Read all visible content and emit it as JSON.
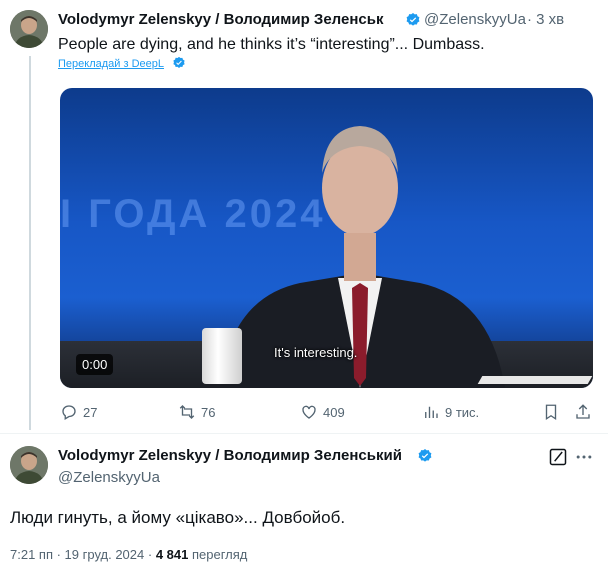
{
  "reply_tweet": {
    "author_name": "Volodymyr Zelenskyy / Володимир Зеленськ",
    "author_handle": "@ZelenskyyUa",
    "time_ago": "· 3 хв",
    "text": "People are dying, and he thinks it’s “interesting”... Dumbass.",
    "translate_label": "Перекладай з DeepL",
    "video": {
      "subtitle": "It's interesting.",
      "timecode": "0:00",
      "background_text": "І ГОДА 2024"
    },
    "actions": {
      "replies": "27",
      "reposts": "76",
      "likes": "409",
      "views": "9 тис."
    }
  },
  "main_tweet": {
    "author_name": "Volodymyr Zelenskyy / Володимир Зеленський",
    "author_handle": "@ZelenskyyUa",
    "text": "Люди гинуть, а йому «цікаво»... Довбойоб.",
    "time": "7:21 пп · 19 груд. 2024 ·",
    "views_count": "4 841",
    "views_label": "перегляд"
  },
  "colors": {
    "accent": "#1d9bf0",
    "text": "#0f1419",
    "secondary": "#536471"
  },
  "icons": [
    "reply-icon",
    "repost-icon",
    "like-icon",
    "views-icon",
    "bookmark-icon",
    "share-icon",
    "verified-icon",
    "grok-icon",
    "more-icon"
  ]
}
